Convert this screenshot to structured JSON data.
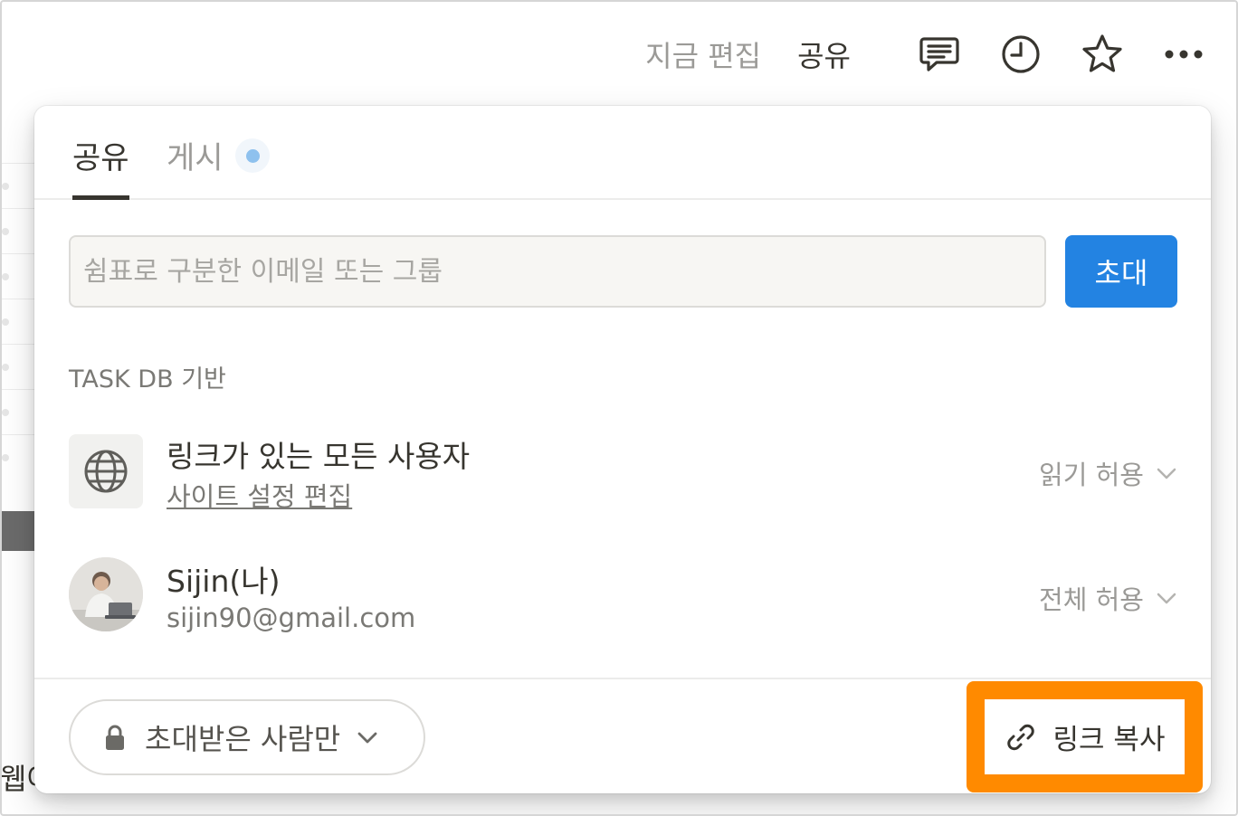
{
  "topbar": {
    "edited_label": "지금 편집",
    "share_label": "공유",
    "icons": [
      "comment-icon",
      "clock-icon",
      "star-icon",
      "more-icon"
    ]
  },
  "popover": {
    "tabs": [
      {
        "label": "공유",
        "active": true
      },
      {
        "label": "게시",
        "active": false
      }
    ],
    "invite": {
      "placeholder": "쉼표로 구분한 이메일 또는 그룹",
      "value": "",
      "button_label": "초대"
    },
    "section_label": "TASK DB 기반",
    "entries": [
      {
        "icon": "globe-icon",
        "title": "링크가 있는 모든 사용자",
        "subtitle": "사이트 설정 편집",
        "permission": "읽기 허용"
      },
      {
        "icon": "avatar",
        "title": "Sijin(나)",
        "subtitle": "sijin90@gmail.com",
        "permission": "전체 허용"
      }
    ],
    "footer": {
      "access_label": "초대받은 사람만",
      "copy_link_label": "링크 복사"
    }
  },
  "background": {
    "partial_text": "웹어"
  },
  "colors": {
    "accent": "#2383e2",
    "highlight": "#ff8a00",
    "text": "#37352f",
    "muted": "#9b9a97"
  }
}
